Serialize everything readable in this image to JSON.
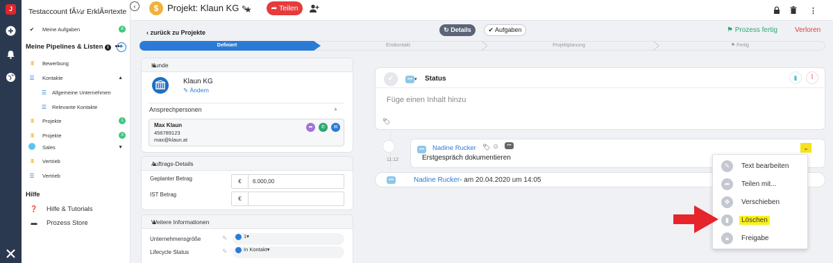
{
  "rail": {
    "logo": "J",
    "icons": [
      "plus-icon",
      "bell-icon",
      "globe-icon",
      "tools-icon"
    ]
  },
  "sidebar": {
    "account": "Testaccount fÃ¼r ErklÃ¤rtexte",
    "my_tasks": {
      "label": "Meine Aufgaben",
      "count": "8"
    },
    "pipelines_title": "Meine Pipelines & Listen",
    "items": [
      {
        "label": "Bewerbung",
        "type": "pipeline"
      },
      {
        "label": "Kontakte",
        "type": "list",
        "expanded": true
      },
      {
        "label": "Allgemeine Unternehmen",
        "type": "list",
        "sub": true
      },
      {
        "label": "Relevante Kontakte",
        "type": "list",
        "sub": true
      },
      {
        "label": "Projekte",
        "type": "pipeline",
        "count": "1"
      },
      {
        "label": "Projekte",
        "type": "pipeline",
        "count": "3"
      },
      {
        "label": "Sales",
        "type": "folder"
      },
      {
        "label": "Vertrieb",
        "type": "pipeline"
      },
      {
        "label": "Vertrieb",
        "type": "list"
      }
    ],
    "help_title": "Hilfe",
    "help_items": [
      {
        "label": "Hilfe & Tutorials"
      },
      {
        "label": "Prozess Store"
      }
    ]
  },
  "topbar": {
    "project_title": "Projekt: Klaun KG",
    "share_label": "Teilen"
  },
  "subbar": {
    "back_label": "zurück zu Projekte",
    "tabs": [
      {
        "label": "Details"
      },
      {
        "label": "Aufgaben"
      }
    ],
    "done_label": "Prozess fertig",
    "lost_label": "Verloren"
  },
  "stepper": {
    "steps": [
      {
        "label": "Definiert",
        "active": true
      },
      {
        "label": "Erstkontakt",
        "active": false
      },
      {
        "label": "Projektplanung",
        "active": false
      },
      {
        "label": "Fertig",
        "active": false
      }
    ]
  },
  "customer": {
    "section_title": "Kunde",
    "name": "Klaun KG",
    "edit_label": "Ändern",
    "contacts_title": "Ansprechpersonen",
    "contact": {
      "name": "Max Klaun",
      "phone": "456789123",
      "email": "max@klaun.at"
    }
  },
  "order": {
    "section_title": "Auftrags-Details",
    "planned_label": "Geplanter Betrag",
    "planned_currency": "€",
    "planned_value": "6.000,00",
    "actual_label": "IST Betrag",
    "actual_currency": "€",
    "actual_value": ""
  },
  "more": {
    "section_title": "Weitere Informationen",
    "size_label": "Unternehmensgröße",
    "size_value": "1",
    "lifecycle_label": "Lifecycle Status",
    "lifecycle_value": "In Kontakt"
  },
  "editor": {
    "status_label": "Status",
    "placeholder": "Füge einen Inhalt hinzu"
  },
  "timeline": {
    "time": "11:12",
    "author": "Nadine Rucker",
    "text": "Erstgespräch dokumentieren",
    "log_author": "Nadine Rucker",
    "log_suffix": "- am 20.04.2020 um 14:05"
  },
  "context_menu": {
    "items": [
      {
        "label": "Text bearbeiten",
        "icon": "pencil-icon"
      },
      {
        "label": "Teilen mit...",
        "icon": "share-icon"
      },
      {
        "label": "Verschieben",
        "icon": "move-icon"
      },
      {
        "label": "Löschen",
        "icon": "trash-icon",
        "highlight": true
      },
      {
        "label": "Freigabe",
        "icon": "lock-icon"
      }
    ]
  },
  "colors": {
    "rail": "#2b3950",
    "accent_blue": "#2b7bd6",
    "share_red": "#e53b3b",
    "success_green": "#2aa772",
    "highlight_yellow": "#f9f01c"
  }
}
